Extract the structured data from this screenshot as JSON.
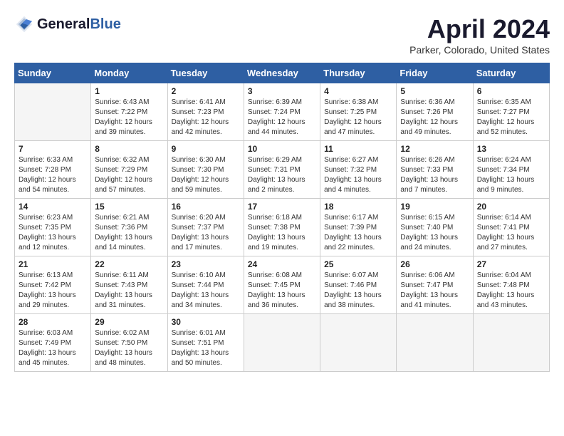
{
  "header": {
    "logo_line1": "General",
    "logo_line2": "Blue",
    "month_year": "April 2024",
    "location": "Parker, Colorado, United States"
  },
  "days_of_week": [
    "Sunday",
    "Monday",
    "Tuesday",
    "Wednesday",
    "Thursday",
    "Friday",
    "Saturday"
  ],
  "weeks": [
    [
      {
        "day": "",
        "empty": true
      },
      {
        "day": "1",
        "sunrise": "Sunrise: 6:43 AM",
        "sunset": "Sunset: 7:22 PM",
        "daylight": "Daylight: 12 hours and 39 minutes."
      },
      {
        "day": "2",
        "sunrise": "Sunrise: 6:41 AM",
        "sunset": "Sunset: 7:23 PM",
        "daylight": "Daylight: 12 hours and 42 minutes."
      },
      {
        "day": "3",
        "sunrise": "Sunrise: 6:39 AM",
        "sunset": "Sunset: 7:24 PM",
        "daylight": "Daylight: 12 hours and 44 minutes."
      },
      {
        "day": "4",
        "sunrise": "Sunrise: 6:38 AM",
        "sunset": "Sunset: 7:25 PM",
        "daylight": "Daylight: 12 hours and 47 minutes."
      },
      {
        "day": "5",
        "sunrise": "Sunrise: 6:36 AM",
        "sunset": "Sunset: 7:26 PM",
        "daylight": "Daylight: 12 hours and 49 minutes."
      },
      {
        "day": "6",
        "sunrise": "Sunrise: 6:35 AM",
        "sunset": "Sunset: 7:27 PM",
        "daylight": "Daylight: 12 hours and 52 minutes."
      }
    ],
    [
      {
        "day": "7",
        "sunrise": "Sunrise: 6:33 AM",
        "sunset": "Sunset: 7:28 PM",
        "daylight": "Daylight: 12 hours and 54 minutes."
      },
      {
        "day": "8",
        "sunrise": "Sunrise: 6:32 AM",
        "sunset": "Sunset: 7:29 PM",
        "daylight": "Daylight: 12 hours and 57 minutes."
      },
      {
        "day": "9",
        "sunrise": "Sunrise: 6:30 AM",
        "sunset": "Sunset: 7:30 PM",
        "daylight": "Daylight: 12 hours and 59 minutes."
      },
      {
        "day": "10",
        "sunrise": "Sunrise: 6:29 AM",
        "sunset": "Sunset: 7:31 PM",
        "daylight": "Daylight: 13 hours and 2 minutes."
      },
      {
        "day": "11",
        "sunrise": "Sunrise: 6:27 AM",
        "sunset": "Sunset: 7:32 PM",
        "daylight": "Daylight: 13 hours and 4 minutes."
      },
      {
        "day": "12",
        "sunrise": "Sunrise: 6:26 AM",
        "sunset": "Sunset: 7:33 PM",
        "daylight": "Daylight: 13 hours and 7 minutes."
      },
      {
        "day": "13",
        "sunrise": "Sunrise: 6:24 AM",
        "sunset": "Sunset: 7:34 PM",
        "daylight": "Daylight: 13 hours and 9 minutes."
      }
    ],
    [
      {
        "day": "14",
        "sunrise": "Sunrise: 6:23 AM",
        "sunset": "Sunset: 7:35 PM",
        "daylight": "Daylight: 13 hours and 12 minutes."
      },
      {
        "day": "15",
        "sunrise": "Sunrise: 6:21 AM",
        "sunset": "Sunset: 7:36 PM",
        "daylight": "Daylight: 13 hours and 14 minutes."
      },
      {
        "day": "16",
        "sunrise": "Sunrise: 6:20 AM",
        "sunset": "Sunset: 7:37 PM",
        "daylight": "Daylight: 13 hours and 17 minutes."
      },
      {
        "day": "17",
        "sunrise": "Sunrise: 6:18 AM",
        "sunset": "Sunset: 7:38 PM",
        "daylight": "Daylight: 13 hours and 19 minutes."
      },
      {
        "day": "18",
        "sunrise": "Sunrise: 6:17 AM",
        "sunset": "Sunset: 7:39 PM",
        "daylight": "Daylight: 13 hours and 22 minutes."
      },
      {
        "day": "19",
        "sunrise": "Sunrise: 6:15 AM",
        "sunset": "Sunset: 7:40 PM",
        "daylight": "Daylight: 13 hours and 24 minutes."
      },
      {
        "day": "20",
        "sunrise": "Sunrise: 6:14 AM",
        "sunset": "Sunset: 7:41 PM",
        "daylight": "Daylight: 13 hours and 27 minutes."
      }
    ],
    [
      {
        "day": "21",
        "sunrise": "Sunrise: 6:13 AM",
        "sunset": "Sunset: 7:42 PM",
        "daylight": "Daylight: 13 hours and 29 minutes."
      },
      {
        "day": "22",
        "sunrise": "Sunrise: 6:11 AM",
        "sunset": "Sunset: 7:43 PM",
        "daylight": "Daylight: 13 hours and 31 minutes."
      },
      {
        "day": "23",
        "sunrise": "Sunrise: 6:10 AM",
        "sunset": "Sunset: 7:44 PM",
        "daylight": "Daylight: 13 hours and 34 minutes."
      },
      {
        "day": "24",
        "sunrise": "Sunrise: 6:08 AM",
        "sunset": "Sunset: 7:45 PM",
        "daylight": "Daylight: 13 hours and 36 minutes."
      },
      {
        "day": "25",
        "sunrise": "Sunrise: 6:07 AM",
        "sunset": "Sunset: 7:46 PM",
        "daylight": "Daylight: 13 hours and 38 minutes."
      },
      {
        "day": "26",
        "sunrise": "Sunrise: 6:06 AM",
        "sunset": "Sunset: 7:47 PM",
        "daylight": "Daylight: 13 hours and 41 minutes."
      },
      {
        "day": "27",
        "sunrise": "Sunrise: 6:04 AM",
        "sunset": "Sunset: 7:48 PM",
        "daylight": "Daylight: 13 hours and 43 minutes."
      }
    ],
    [
      {
        "day": "28",
        "sunrise": "Sunrise: 6:03 AM",
        "sunset": "Sunset: 7:49 PM",
        "daylight": "Daylight: 13 hours and 45 minutes."
      },
      {
        "day": "29",
        "sunrise": "Sunrise: 6:02 AM",
        "sunset": "Sunset: 7:50 PM",
        "daylight": "Daylight: 13 hours and 48 minutes."
      },
      {
        "day": "30",
        "sunrise": "Sunrise: 6:01 AM",
        "sunset": "Sunset: 7:51 PM",
        "daylight": "Daylight: 13 hours and 50 minutes."
      },
      {
        "day": "",
        "empty": true
      },
      {
        "day": "",
        "empty": true
      },
      {
        "day": "",
        "empty": true
      },
      {
        "day": "",
        "empty": true
      }
    ]
  ]
}
